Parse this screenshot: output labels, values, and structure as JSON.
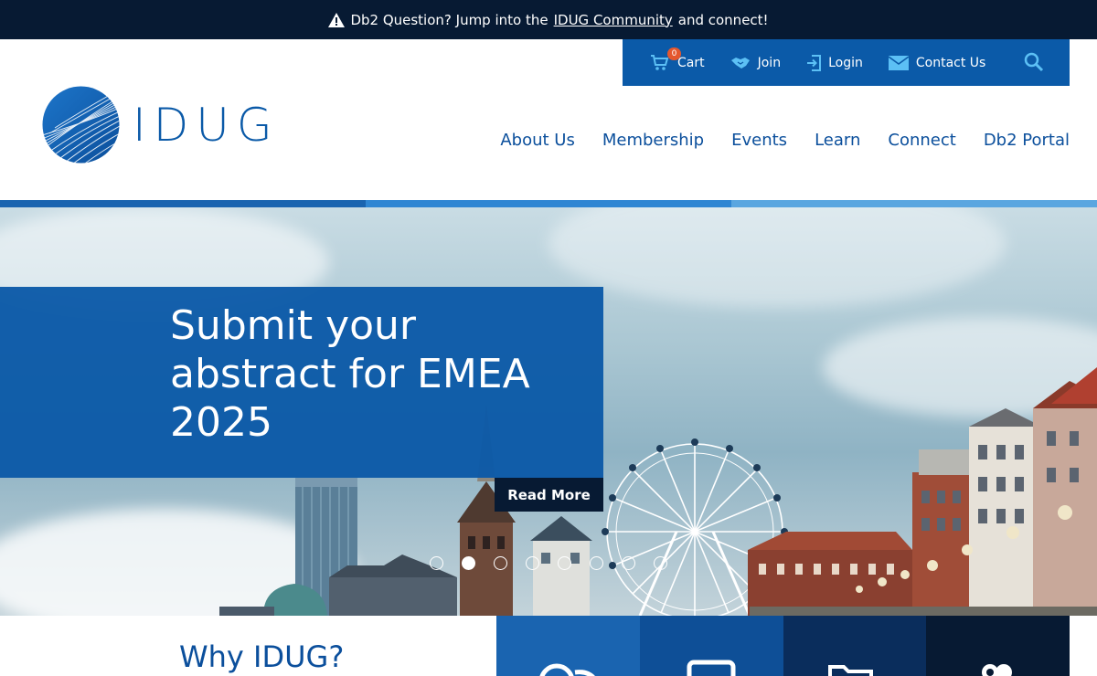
{
  "announcement": {
    "prefix": "Db2 Question? Jump into the",
    "link": "IDUG Community",
    "suffix": "and connect!",
    "icon": "warning-icon"
  },
  "utility": {
    "cart_label": "Cart",
    "cart_count": "0",
    "join_label": "Join",
    "login_label": "Login",
    "contact_label": "Contact Us"
  },
  "logo": {
    "text": "IDUG"
  },
  "nav": {
    "about": "About Us",
    "membership": "Membership",
    "events": "Events",
    "learn": "Learn",
    "connect": "Connect",
    "portal": "Db2 Portal"
  },
  "hero": {
    "title": "Submit your abstract for EMEA 2025",
    "button": "Read More",
    "slide_count": 8,
    "active_slide": 2
  },
  "why": {
    "title": "Why IDUG?"
  },
  "colors": {
    "navy": "#071a33",
    "brand_blue": "#0b5aa8",
    "accent_orange": "#e4572e",
    "tile_colors": [
      "#1a64b0",
      "#0e4f97",
      "#0a2d5c",
      "#071a33"
    ]
  }
}
